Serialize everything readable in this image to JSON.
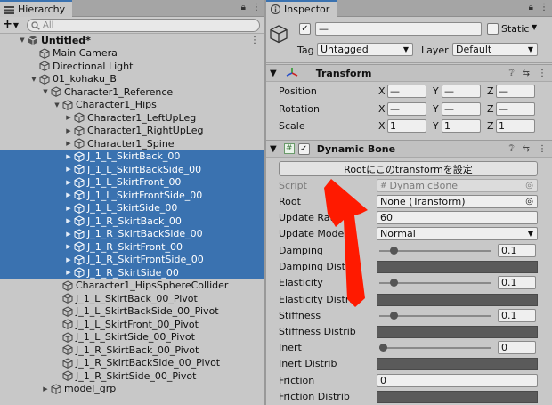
{
  "hierarchy": {
    "tab_label": "Hierarchy",
    "search_placeholder": "All",
    "scene_name": "Untitled*",
    "items": [
      {
        "label": "Main Camera"
      },
      {
        "label": "Directional Light"
      },
      {
        "label": "01_kohaku_B"
      },
      {
        "label": "Character1_Reference"
      },
      {
        "label": "Character1_Hips"
      },
      {
        "label": "Character1_LeftUpLeg"
      },
      {
        "label": "Character1_RightUpLeg"
      },
      {
        "label": "Character1_Spine"
      },
      {
        "label": "J_1_L_SkirtBack_00"
      },
      {
        "label": "J_1_L_SkirtBackSide_00"
      },
      {
        "label": "J_1_L_SkirtFront_00"
      },
      {
        "label": "J_1_L_SkirtFrontSide_00"
      },
      {
        "label": "J_1_L_SkirtSide_00"
      },
      {
        "label": "J_1_R_SkirtBack_00"
      },
      {
        "label": "J_1_R_SkirtBackSide_00"
      },
      {
        "label": "J_1_R_SkirtFront_00"
      },
      {
        "label": "J_1_R_SkirtFrontSide_00"
      },
      {
        "label": "J_1_R_SkirtSide_00"
      },
      {
        "label": "Character1_HipsSphereCollider"
      },
      {
        "label": "J_1_L_SkirtBack_00_Pivot"
      },
      {
        "label": "J_1_L_SkirtBackSide_00_Pivot"
      },
      {
        "label": "J_1_L_SkirtFront_00_Pivot"
      },
      {
        "label": "J_1_L_SkirtSide_00_Pivot"
      },
      {
        "label": "J_1_R_SkirtBack_00_Pivot"
      },
      {
        "label": "J_1_R_SkirtBackSide_00_Pivot"
      },
      {
        "label": "J_1_R_SkirtSide_00_Pivot"
      },
      {
        "label": "model_grp"
      }
    ]
  },
  "inspector": {
    "tab_label": "Inspector",
    "name_value": "—",
    "static_label": "Static",
    "tag_label": "Tag",
    "tag_value": "Untagged",
    "layer_label": "Layer",
    "layer_value": "Default",
    "transform": {
      "title": "Transform",
      "position_label": "Position",
      "rotation_label": "Rotation",
      "scale_label": "Scale",
      "x": "X",
      "y": "Y",
      "z": "Z",
      "position": [
        "—",
        "—",
        "—"
      ],
      "rotation": [
        "—",
        "—",
        "—"
      ],
      "scale": [
        "1",
        "1",
        "1"
      ]
    },
    "dynamic_bone": {
      "title": "Dynamic Bone",
      "set_root_button": "Rootにこのtransformを設定",
      "script_label": "Script",
      "script_value": "DynamicBone",
      "root_label": "Root",
      "root_value": "None (Transform)",
      "update_rate_label": "Update Rate",
      "update_rate_value": "60",
      "update_mode_label": "Update Mode",
      "update_mode_value": "Normal",
      "damping_label": "Damping",
      "damping_value": "0.1",
      "damping_distrib_label": "Damping Distrib",
      "elasticity_label": "Elasticity",
      "elasticity_value": "0.1",
      "elasticity_distrib_label": "Elasticity Distrib",
      "stiffness_label": "Stiffness",
      "stiffness_value": "0.1",
      "stiffness_distrib_label": "Stiffness Distrib",
      "inert_label": "Inert",
      "inert_value": "0",
      "inert_distrib_label": "Inert Distrib",
      "friction_label": "Friction",
      "friction_value": "0",
      "friction_distrib_label": "Friction Distrib"
    }
  },
  "colors": {
    "selection": "#3a72b0",
    "annotation_arrow": "#ff1a00"
  }
}
